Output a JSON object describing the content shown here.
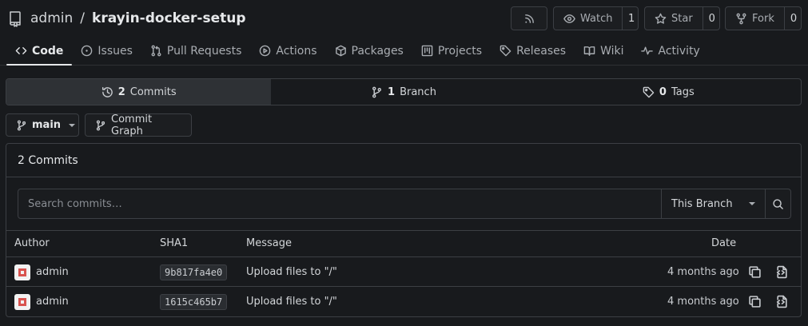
{
  "repo": {
    "owner": "admin",
    "separator": "/",
    "name": "krayin-docker-setup"
  },
  "header_buttons": {
    "watch": {
      "label": "Watch",
      "count": "1"
    },
    "star": {
      "label": "Star",
      "count": "0"
    },
    "fork": {
      "label": "Fork",
      "count": "0"
    }
  },
  "tabs": [
    {
      "label": "Code",
      "icon": "code-icon",
      "active": true
    },
    {
      "label": "Issues",
      "icon": "issue-icon"
    },
    {
      "label": "Pull Requests",
      "icon": "pull-request-icon"
    },
    {
      "label": "Actions",
      "icon": "play-icon"
    },
    {
      "label": "Packages",
      "icon": "package-icon"
    },
    {
      "label": "Projects",
      "icon": "project-icon"
    },
    {
      "label": "Releases",
      "icon": "tag-icon"
    },
    {
      "label": "Wiki",
      "icon": "book-icon"
    },
    {
      "label": "Activity",
      "icon": "pulse-icon"
    }
  ],
  "stats": {
    "commits": {
      "count": "2",
      "label": "Commits"
    },
    "branches": {
      "count": "1",
      "label": "Branch"
    },
    "tags": {
      "count": "0",
      "label": "Tags"
    }
  },
  "branch_selector": {
    "value": "main"
  },
  "commit_graph_label": "Commit Graph",
  "commits_panel": {
    "title": "2 Commits",
    "search_placeholder": "Search commits…",
    "scope": "This Branch",
    "columns": {
      "author": "Author",
      "sha": "SHA1",
      "message": "Message",
      "date": "Date"
    },
    "rows": [
      {
        "author": "admin",
        "sha": "9b817fa4e0",
        "message": "Upload files to \"/\"",
        "date": "4 months ago"
      },
      {
        "author": "admin",
        "sha": "1615c465b7",
        "message": "Upload files to \"/\"",
        "date": "4 months ago"
      }
    ]
  },
  "colors": {
    "background": "#181a1d",
    "border": "#3c3f44",
    "text": "#d3d6d9",
    "avatar_accent": "#d9534f"
  }
}
